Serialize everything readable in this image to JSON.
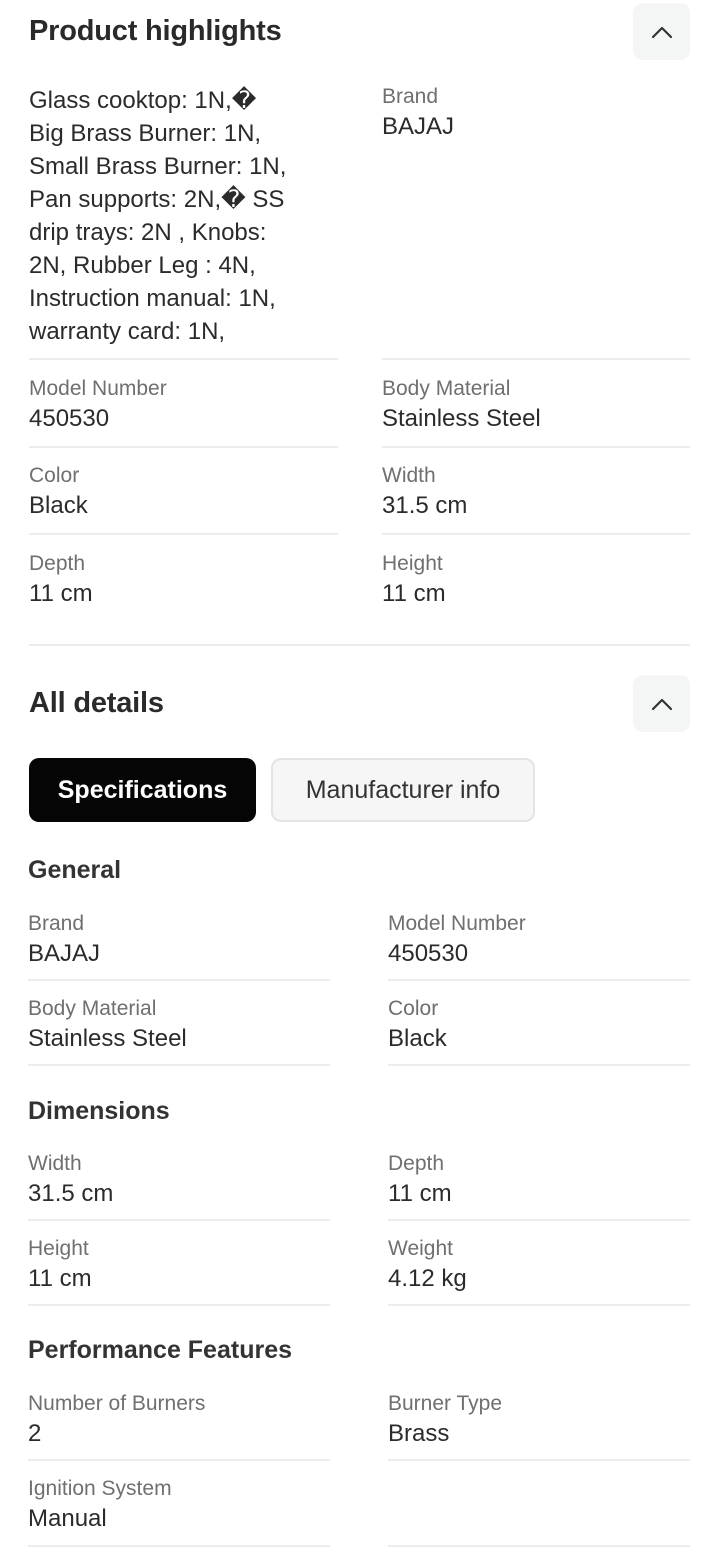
{
  "highlights": {
    "title": "Product highlights",
    "box_contents_lines": [
      "Glass cooktop: 1N,�",
      "Big Brass Burner: 1N,",
      "Small Brass Burner: 1N,",
      "Pan supports: 2N,� SS",
      "drip trays: 2N , Knobs:",
      "2N, Rubber Leg : 4N,",
      "Instruction manual: 1N,",
      "warranty card: 1N,"
    ],
    "brand_label": "Brand",
    "brand_value": "BAJAJ",
    "model_label": "Model Number",
    "model_value": "450530",
    "material_label": "Body Material",
    "material_value": "Stainless Steel",
    "color_label": "Color",
    "color_value": "Black",
    "width_label": "Width",
    "width_value": "31.5 cm",
    "depth_label": "Depth",
    "depth_value": "11 cm",
    "height_label": "Height",
    "height_value": "11 cm"
  },
  "details": {
    "title": "All details",
    "tabs": [
      {
        "label": "Specifications",
        "active": true
      },
      {
        "label": "Manufacturer info",
        "active": false
      }
    ],
    "general": {
      "title": "General",
      "brand_label": "Brand",
      "brand_value": "BAJAJ",
      "model_label": "Model Number",
      "model_value": "450530",
      "material_label": "Body Material",
      "material_value": "Stainless Steel",
      "color_label": "Color",
      "color_value": "Black"
    },
    "dimensions": {
      "title": "Dimensions",
      "width_label": "Width",
      "width_value": "31.5 cm",
      "depth_label": "Depth",
      "depth_value": "11 cm",
      "height_label": "Height",
      "height_value": "11 cm",
      "weight_label": "Weight",
      "weight_value": "4.12 kg"
    },
    "performance": {
      "title": "Performance Features",
      "burners_label": "Number of Burners",
      "burners_value": "2",
      "burner_type_label": "Burner Type",
      "burner_type_value": "Brass",
      "ignition_label": "Ignition System",
      "ignition_value": "Manual"
    }
  },
  "icons": {
    "collapse": "chevron-up-icon"
  },
  "colors": {
    "active_tab_bg": "#050505",
    "inactive_tab_bg": "#f6f6f6",
    "collapse_btn_bg": "#f4f5f5",
    "divider": "#ececec"
  }
}
